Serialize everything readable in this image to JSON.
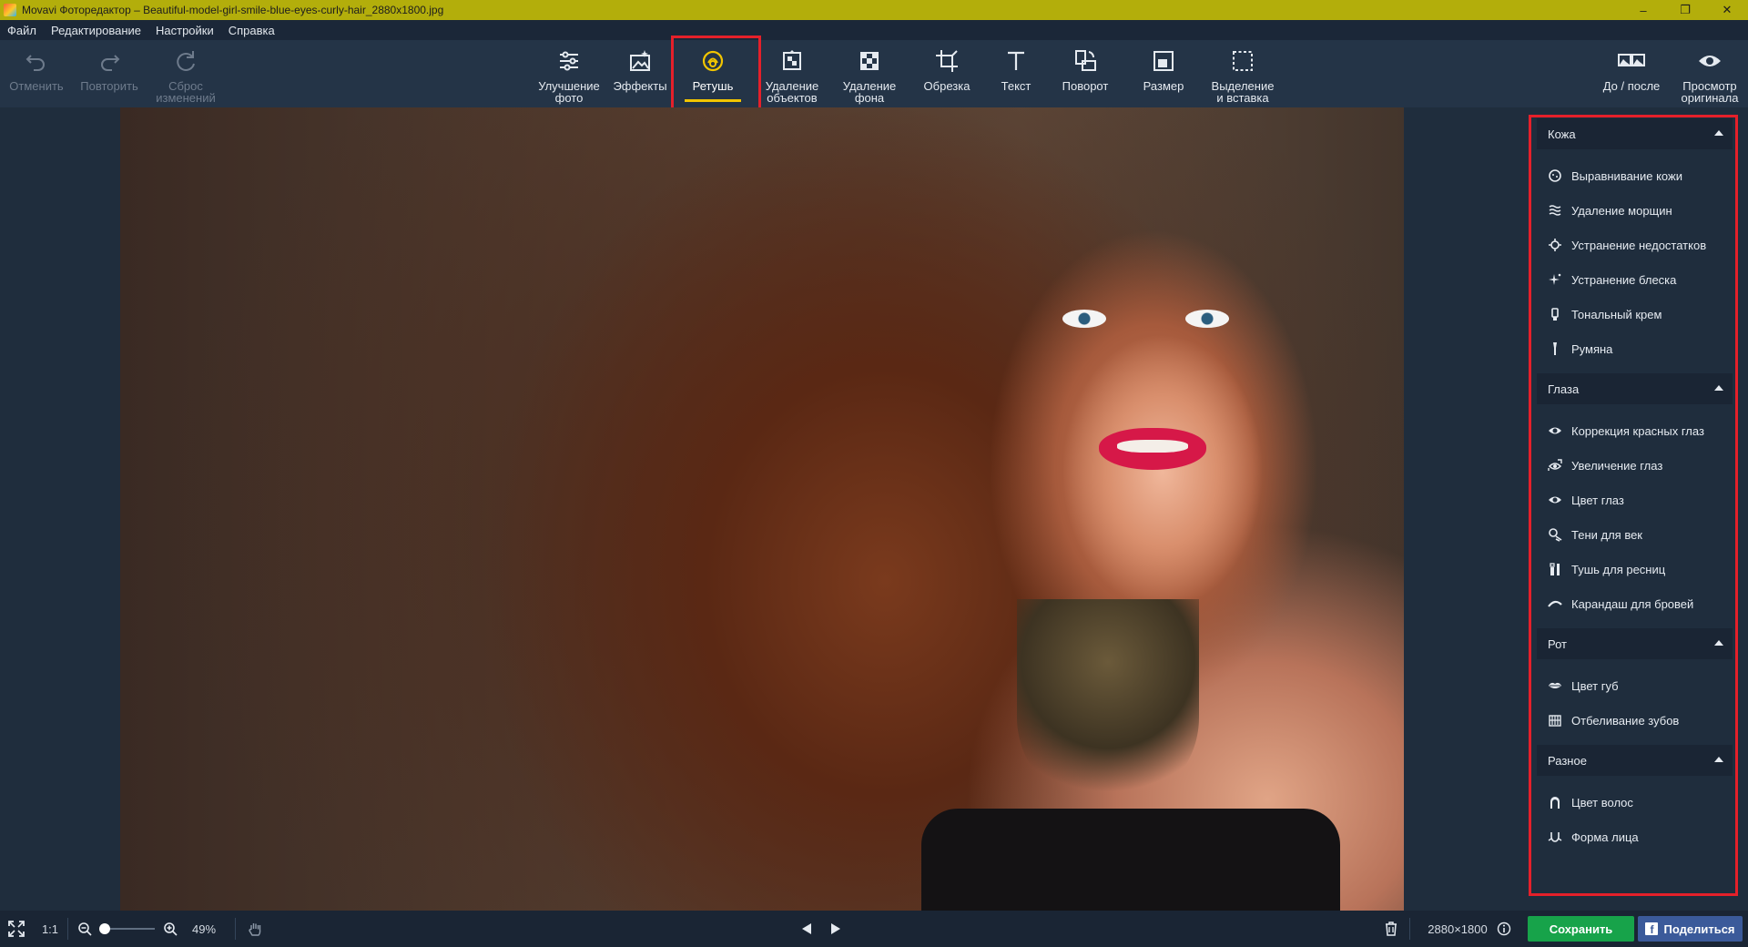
{
  "window": {
    "title": "Movavi Фоторедактор – Beautiful-model-girl-smile-blue-eyes-curly-hair_2880x1800.jpg",
    "controls": [
      "–",
      "❐",
      "✕"
    ]
  },
  "menu": [
    "Файл",
    "Редактирование",
    "Настройки",
    "Справка"
  ],
  "toolbar": {
    "left": [
      {
        "label": "Отменить",
        "icon": "undo-icon",
        "enabled": false
      },
      {
        "label": "Повторить",
        "icon": "redo-icon",
        "enabled": false
      },
      {
        "label": "Сброс\nизменений",
        "icon": "reset-icon",
        "enabled": false
      }
    ],
    "tools": [
      {
        "label": "Улучшение\nфото",
        "icon": "sliders-icon"
      },
      {
        "label": "Эффекты",
        "icon": "effects-icon"
      },
      {
        "label": "Ретушь",
        "icon": "retouch-icon",
        "active": true
      },
      {
        "label": "Удаление\nобъектов",
        "icon": "object-removal-icon"
      },
      {
        "label": "Удаление\nфона",
        "icon": "background-removal-icon"
      },
      {
        "label": "Обрезка",
        "icon": "crop-icon"
      },
      {
        "label": "Текст",
        "icon": "text-icon"
      },
      {
        "label": "Поворот",
        "icon": "rotate-icon"
      },
      {
        "label": "Размер",
        "icon": "resize-icon"
      },
      {
        "label": "Выделение\nи вставка",
        "icon": "select-paste-icon"
      }
    ],
    "right": [
      {
        "label": "До / после",
        "icon": "before-after-icon"
      },
      {
        "label": "Просмотр\nоригинала",
        "icon": "eye-icon"
      }
    ],
    "accent_color": "#f2c500"
  },
  "panel": {
    "sections": [
      {
        "title": "Кожа",
        "items": [
          {
            "label": "Выравнивание кожи",
            "icon": "skin-smoothing-icon"
          },
          {
            "label": "Удаление морщин",
            "icon": "wrinkle-icon"
          },
          {
            "label": "Устранение недостатков",
            "icon": "blemish-icon"
          },
          {
            "label": "Устранение блеска",
            "icon": "shine-icon"
          },
          {
            "label": "Тональный крем",
            "icon": "foundation-icon"
          },
          {
            "label": "Румяна",
            "icon": "blush-icon"
          }
        ]
      },
      {
        "title": "Глаза",
        "items": [
          {
            "label": "Коррекция красных глаз",
            "icon": "red-eye-icon"
          },
          {
            "label": "Увеличение глаз",
            "icon": "eye-enlarge-icon"
          },
          {
            "label": "Цвет глаз",
            "icon": "eye-color-icon"
          },
          {
            "label": "Тени для век",
            "icon": "eyeshadow-icon"
          },
          {
            "label": "Тушь для ресниц",
            "icon": "mascara-icon"
          },
          {
            "label": "Карандаш для бровей",
            "icon": "eyebrow-icon"
          }
        ]
      },
      {
        "title": "Рот",
        "items": [
          {
            "label": "Цвет губ",
            "icon": "lips-icon"
          },
          {
            "label": "Отбеливание зубов",
            "icon": "teeth-icon"
          }
        ]
      },
      {
        "title": "Разное",
        "items": [
          {
            "label": "Цвет волос",
            "icon": "hair-icon"
          },
          {
            "label": "Форма лица",
            "icon": "face-shape-icon"
          }
        ]
      }
    ]
  },
  "status": {
    "ratio": "1:1",
    "zoom": "49%",
    "zoom_fraction": 0.05,
    "dimensions": "2880×1800",
    "save": "Сохранить",
    "share": "Поделиться",
    "fb_glyph": "f"
  }
}
